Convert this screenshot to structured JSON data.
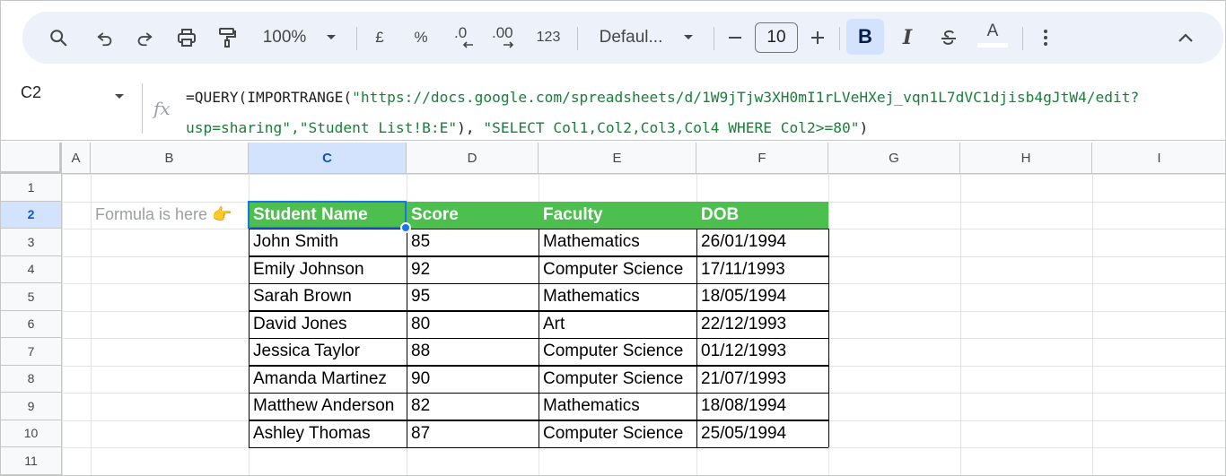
{
  "toolbar": {
    "zoom": "100%",
    "currency": "£",
    "percent": "%",
    "decrease_decimal": ".0",
    "increase_decimal": ".00",
    "number_format": "123",
    "font_family": "Defaul...",
    "font_size": "10",
    "bold": "B",
    "italic": "I",
    "text_color": "A",
    "icons": [
      "search-icon",
      "undo-icon",
      "redo-icon",
      "print-icon",
      "paint-format-icon",
      "chevron-down-icon",
      "minus-icon",
      "plus-icon",
      "strikethrough-icon",
      "more-icon",
      "collapse-icon"
    ]
  },
  "formula_bar": {
    "name_box": "C2",
    "fx": "fx",
    "formula_prefix": "=QUERY(IMPORTRANGE(",
    "formula_url_1": "\"https://docs.google.com/spreadsheets/d/1W9jTjw3XH0mI1rLVeHXej_vqn1L7dVC1djisb4gJtW4/edit?",
    "formula_url_2": "usp=sharing\",\"Student List!B:E\"",
    "formula_mid": "), ",
    "formula_query": "\"SELECT Col1,Col2,Col3,Col4 WHERE Col2>=80\"",
    "formula_end": ")"
  },
  "columns": [
    "A",
    "B",
    "C",
    "D",
    "E",
    "F",
    "G",
    "H",
    "I"
  ],
  "rows": [
    "1",
    "2",
    "3",
    "4",
    "5",
    "6",
    "7",
    "8",
    "9",
    "10",
    "11"
  ],
  "selected_cell": "C2",
  "note": "Formula is here 👉",
  "table": {
    "headers": [
      "Student Name",
      "Score",
      "Faculty",
      "DOB"
    ],
    "rows": [
      [
        "John Smith",
        "85",
        "Mathematics",
        "26/01/1994"
      ],
      [
        "Emily Johnson",
        "92",
        "Computer Science",
        "17/11/1993"
      ],
      [
        "Sarah Brown",
        "95",
        "Mathematics",
        "18/05/1994"
      ],
      [
        "David Jones",
        "80",
        "Art",
        "22/12/1993"
      ],
      [
        "Jessica Taylor",
        "88",
        "Computer Science",
        "01/12/1993"
      ],
      [
        "Amanda Martinez",
        "90",
        "Computer Science",
        "21/07/1993"
      ],
      [
        "Matthew Anderson",
        "82",
        "Mathematics",
        "18/08/1994"
      ],
      [
        "Ashley Thomas",
        "87",
        "Computer Science",
        "25/05/1994"
      ]
    ]
  },
  "colors": {
    "header_fill": "#4cbf4f",
    "selection": "#1a73e8",
    "toolbar_bg": "#edf2fa"
  }
}
